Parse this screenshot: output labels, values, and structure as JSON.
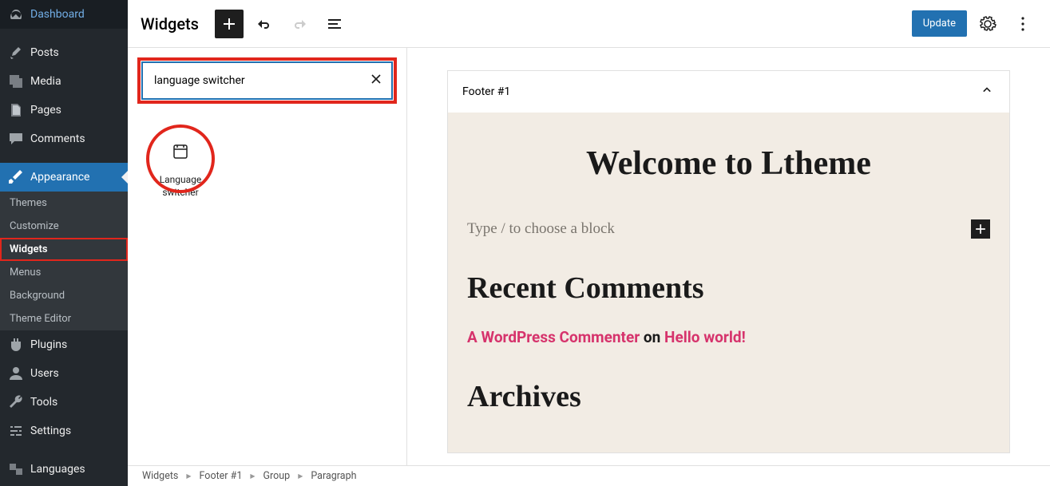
{
  "sidebar": {
    "items": [
      {
        "label": "Dashboard",
        "icon": "dashboard"
      },
      {
        "label": "Posts",
        "icon": "pin"
      },
      {
        "label": "Media",
        "icon": "media"
      },
      {
        "label": "Pages",
        "icon": "pages"
      },
      {
        "label": "Comments",
        "icon": "comment"
      },
      {
        "label": "Appearance",
        "icon": "brush"
      },
      {
        "label": "Plugins",
        "icon": "plugin"
      },
      {
        "label": "Users",
        "icon": "user"
      },
      {
        "label": "Tools",
        "icon": "wrench"
      },
      {
        "label": "Settings",
        "icon": "sliders"
      },
      {
        "label": "Languages",
        "icon": "languages"
      }
    ],
    "appearance_sub": [
      {
        "label": "Themes"
      },
      {
        "label": "Customize"
      },
      {
        "label": "Widgets"
      },
      {
        "label": "Menus"
      },
      {
        "label": "Background"
      },
      {
        "label": "Theme Editor"
      }
    ]
  },
  "toolbar": {
    "title": "Widgets",
    "update_label": "Update"
  },
  "inserter": {
    "search_value": "language switcher",
    "block_label": "Language switcher"
  },
  "canvas": {
    "area_title": "Footer #1",
    "welcome": "Welcome to Ltheme",
    "type_placeholder": "Type / to choose a block",
    "recent_heading": "Recent Comments",
    "commenter": "A WordPress Commenter",
    "on_text": " on ",
    "post_title": "Hello world!",
    "archives_heading": "Archives"
  },
  "breadcrumb": {
    "items": [
      "Widgets",
      "Footer #1",
      "Group",
      "Paragraph"
    ]
  },
  "colors": {
    "highlight": "#e1261c",
    "wp_blue": "#2271b1",
    "pink_link": "#d6336c"
  }
}
